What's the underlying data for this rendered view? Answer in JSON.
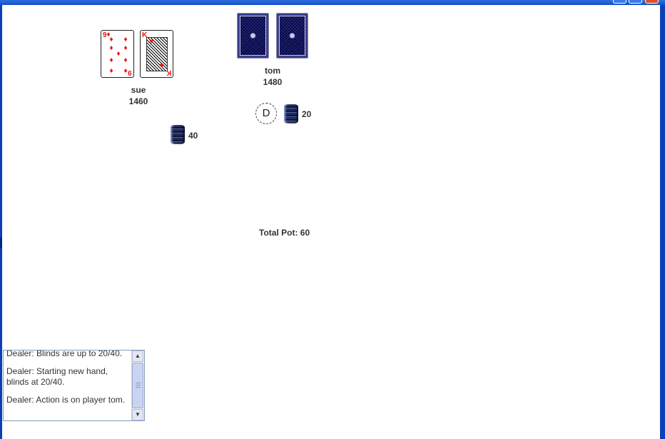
{
  "window": {
    "title": ""
  },
  "players": [
    {
      "name": "sue",
      "chips": "1460",
      "cards": [
        {
          "rank": "9",
          "suit": "hearts",
          "color": "#e11111"
        },
        {
          "rank": "K",
          "suit": "hearts",
          "color": "#e11111"
        }
      ],
      "bet": "40"
    },
    {
      "name": "tom",
      "chips": "1480",
      "cards_face_down": 2,
      "bet": "20"
    }
  ],
  "dealer_button": "D",
  "pot": {
    "label": "Total Pot: 60"
  },
  "chat_log": {
    "lines": [
      "Dealer: Blinds are up to 20/40.",
      "Dealer: Starting new hand, blinds at 20/40.",
      "Dealer: Action is on player tom."
    ]
  },
  "colors": {
    "title_bar": "#1450c8",
    "card_back": "#3b3e8c",
    "suit_red": "#e11111"
  },
  "icons": {
    "suit": "heart-suit-icon",
    "chip": "poker-chip-icon",
    "scroll_up": "arrow-up-icon",
    "scroll_down": "arrow-down-icon"
  }
}
